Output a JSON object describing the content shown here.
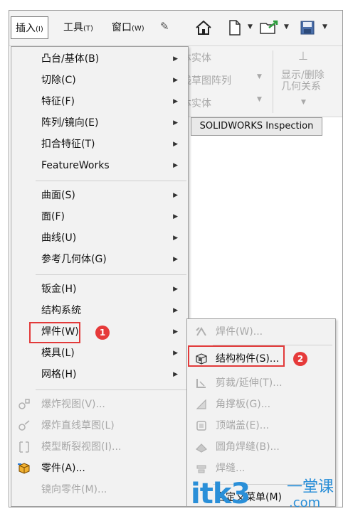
{
  "menubar": {
    "items": [
      {
        "label": "插入",
        "key": "(I)"
      },
      {
        "label": "工具",
        "key": "(T)"
      },
      {
        "label": "窗口",
        "key": "(W)"
      }
    ]
  },
  "ribbon": {
    "texts": [
      "体实体",
      "线草图阵列",
      "体实体",
      "显示/删除",
      "几何关系"
    ],
    "inspection_tab": "SOLIDWORKS Inspection"
  },
  "menu": {
    "items": [
      {
        "label": "凸台/基体(B)",
        "submenu": true,
        "enabled": true
      },
      {
        "label": "切除(C)",
        "submenu": true,
        "enabled": true
      },
      {
        "label": "特征(F)",
        "submenu": true,
        "enabled": true
      },
      {
        "label": "阵列/镜向(E)",
        "submenu": true,
        "enabled": true
      },
      {
        "label": "扣合特征(T)",
        "submenu": true,
        "enabled": true
      },
      {
        "label": "FeatureWorks",
        "submenu": true,
        "enabled": true
      },
      {
        "label": "曲面(S)",
        "submenu": true,
        "enabled": true
      },
      {
        "label": "面(F)",
        "submenu": true,
        "enabled": true
      },
      {
        "label": "曲线(U)",
        "submenu": true,
        "enabled": true
      },
      {
        "label": "参考几何体(G)",
        "submenu": true,
        "enabled": true
      },
      {
        "label": "钣金(H)",
        "submenu": true,
        "enabled": true
      },
      {
        "label": "结构系统",
        "submenu": true,
        "enabled": true
      },
      {
        "label": "焊件(W)",
        "submenu": true,
        "enabled": true
      },
      {
        "label": "模具(L)",
        "submenu": true,
        "enabled": true
      },
      {
        "label": "网格(H)",
        "submenu": true,
        "enabled": true
      },
      {
        "label": "爆炸视图(V)...",
        "submenu": false,
        "enabled": false
      },
      {
        "label": "爆炸直线草图(L)",
        "submenu": false,
        "enabled": false
      },
      {
        "label": "模型断裂视图(I)...",
        "submenu": false,
        "enabled": false
      },
      {
        "label": "零件(A)...",
        "submenu": false,
        "enabled": true
      },
      {
        "label": "镜向零件(M)...",
        "submenu": false,
        "enabled": false
      }
    ]
  },
  "submenu": {
    "items": [
      {
        "label": "焊件(W)...",
        "enabled": false
      },
      {
        "label": "结构构件(S)...",
        "enabled": true
      },
      {
        "label": "剪裁/延伸(T)...",
        "enabled": false
      },
      {
        "label": "角撑板(G)...",
        "enabled": false
      },
      {
        "label": "顶端盖(E)...",
        "enabled": false
      },
      {
        "label": "圆角焊缝(B)...",
        "enabled": false
      },
      {
        "label": "焊缝...",
        "enabled": false
      },
      {
        "label": "自定义菜单(M)",
        "enabled": true
      }
    ]
  },
  "badges": [
    "1",
    "2"
  ],
  "watermark": {
    "main": "itk3",
    "sub": "一堂课",
    "domain": ".com"
  },
  "colors": {
    "highlight": "#e23a3a",
    "watermark": "#2a8fd8"
  }
}
